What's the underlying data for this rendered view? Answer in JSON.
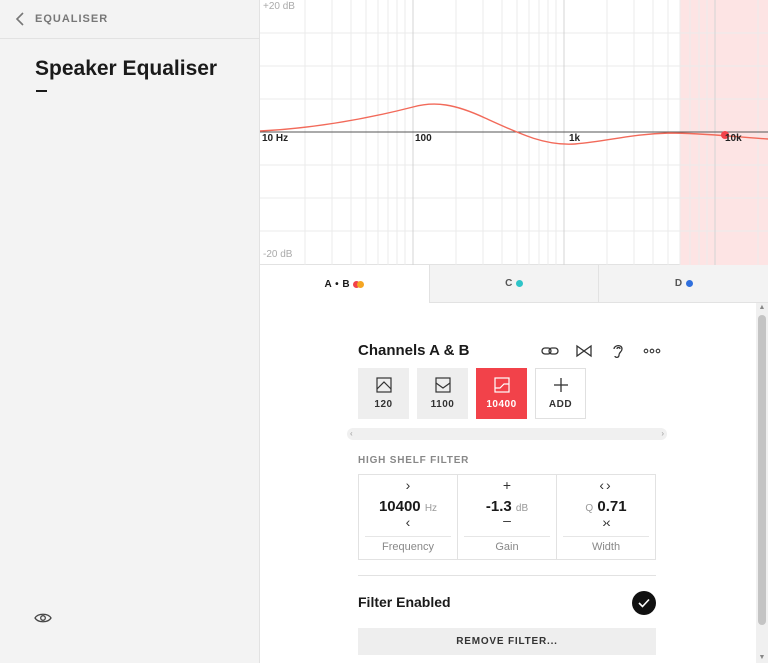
{
  "sidebar": {
    "back_label": "EQUALISER",
    "title": "Speaker Equaliser"
  },
  "graph": {
    "db_top": "+20 dB",
    "db_bottom": "-20 dB",
    "freq_labels": [
      "10 Hz",
      "100",
      "1k",
      "10k"
    ],
    "curve_color": "#f26a5a",
    "highlight_color": "#fde4e4"
  },
  "tabs": [
    {
      "label": "A • B",
      "dots": [
        "#f2424a",
        "#f5a623"
      ],
      "active": true
    },
    {
      "label": "C",
      "dots": [
        "#2ec4c8"
      ],
      "active": false
    },
    {
      "label": "D",
      "dots": [
        "#2f6fdd"
      ],
      "active": false
    }
  ],
  "channel": {
    "title": "Channels A & B",
    "icons": [
      "link-icon",
      "bowtie-icon",
      "ear-icon",
      "more-icon"
    ]
  },
  "filters": [
    {
      "label": "120",
      "icon": "peak-filter-icon",
      "active": false
    },
    {
      "label": "1100",
      "icon": "dip-filter-icon",
      "active": false
    },
    {
      "label": "10400",
      "icon": "high-shelf-icon",
      "active": true
    },
    {
      "label": "ADD",
      "icon": "plus-icon",
      "active": false
    }
  ],
  "section": {
    "label": "HIGH SHELF FILTER"
  },
  "params": {
    "frequency": {
      "value": "10400",
      "unit": "Hz",
      "name": "Frequency"
    },
    "gain": {
      "value": "-1.3",
      "unit": "dB",
      "name": "Gain"
    },
    "width": {
      "prefix": "Q",
      "value": "0.71",
      "name": "Width"
    }
  },
  "filter_enabled": {
    "label": "Filter Enabled",
    "checked": true
  },
  "remove_button": "REMOVE FILTER..."
}
